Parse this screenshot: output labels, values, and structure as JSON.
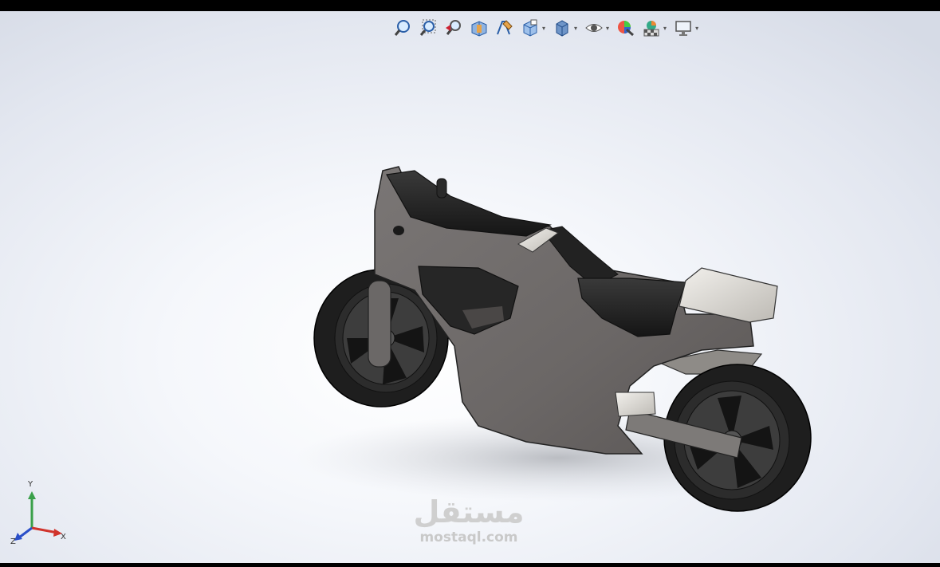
{
  "toolbar": {
    "buttons": [
      {
        "id": "zoom-to-fit",
        "icon": "zoom-to-fit-icon",
        "dropdown": false
      },
      {
        "id": "zoom-to-area",
        "icon": "zoom-to-area-icon",
        "dropdown": false
      },
      {
        "id": "previous-view",
        "icon": "previous-view-icon",
        "dropdown": false
      },
      {
        "id": "section-view",
        "icon": "section-view-icon",
        "dropdown": false
      },
      {
        "id": "dynamic-annotation",
        "icon": "dynamic-annotation-views-icon",
        "dropdown": false
      },
      {
        "id": "view-orientation",
        "icon": "view-orientation-icon",
        "dropdown": true
      },
      {
        "id": "display-style",
        "icon": "display-style-icon",
        "dropdown": true
      },
      {
        "id": "hide-show",
        "icon": "hide-show-items-icon",
        "dropdown": true
      },
      {
        "id": "edit-appearance",
        "icon": "edit-appearance-icon",
        "dropdown": false
      },
      {
        "id": "apply-scene",
        "icon": "apply-scene-icon",
        "dropdown": true
      },
      {
        "id": "view-settings",
        "icon": "view-settings-icon",
        "dropdown": true
      }
    ],
    "dropdown_glyph": "▾"
  },
  "triad": {
    "x_label": "X",
    "y_label": "Y",
    "z_label": "Z",
    "colors": {
      "x": "#d0342c",
      "y": "#3aa04a",
      "z": "#2a4fc9"
    }
  },
  "watermark": {
    "arabic": "مستقل",
    "latin": "mostaql.com"
  },
  "model": {
    "name": "motorcycle-model",
    "colors": {
      "body": "#6f6b6a",
      "body_dark": "#4a4746",
      "seat": "#1c1c1c",
      "tire": "#222222",
      "rim": "#3a3a3a",
      "light_part": "#e4e2dd"
    }
  }
}
